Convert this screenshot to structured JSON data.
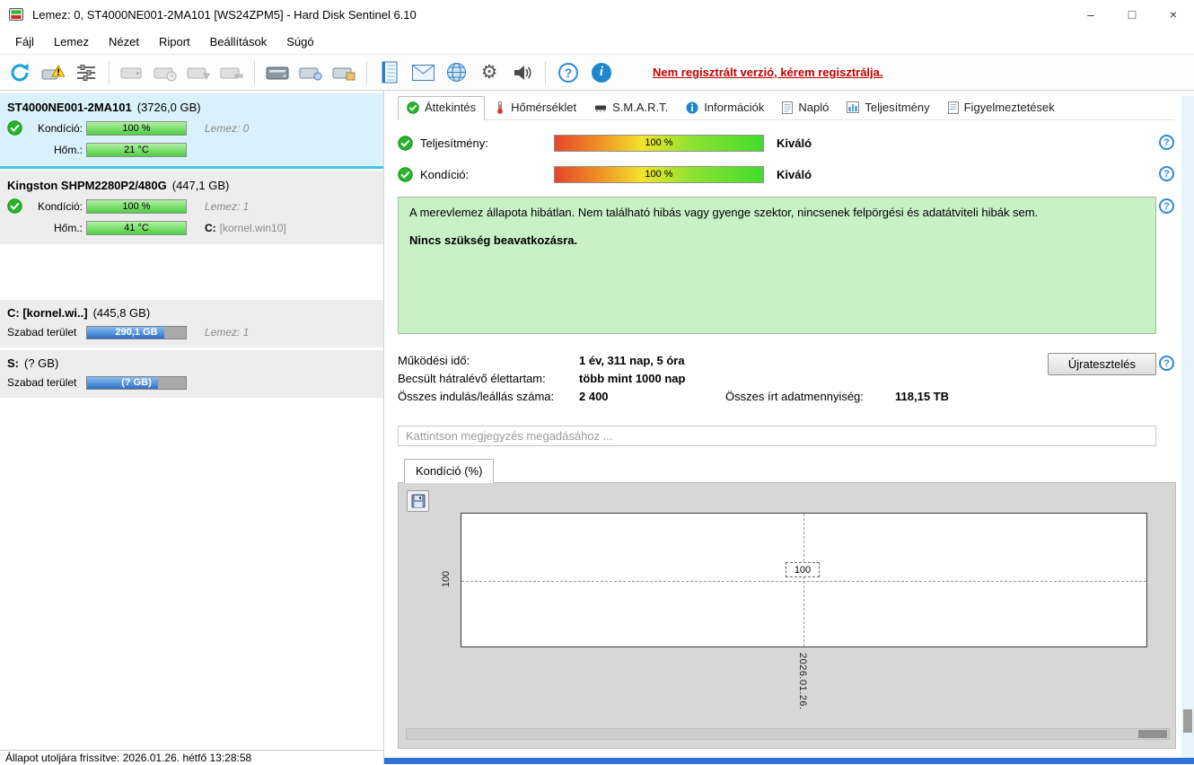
{
  "window": {
    "title": "Lemez: 0, ST4000NE001-2MA101 [WS24ZPM5]  -  Hard Disk Sentinel 6.10",
    "minimize": "–",
    "maximize": "□",
    "close": "×"
  },
  "menu": {
    "items": [
      {
        "label": "Fájl"
      },
      {
        "label": "Lemez"
      },
      {
        "label": "Nézet"
      },
      {
        "label": "Riport"
      },
      {
        "label": "Beállítások"
      },
      {
        "label": "Súgó"
      }
    ]
  },
  "toolbar": {
    "register_text": "Nem regisztrált verzió, kérem regisztrálja.",
    "help_glyph": "?",
    "info_glyph": "i",
    "gear_glyph": "⚙"
  },
  "sidebar": {
    "disks": [
      {
        "name": "ST4000NE001-2MA101",
        "size": "(3726,0 GB)",
        "condition_label": "Kondíció:",
        "condition_value": "100 %",
        "disk_label": "Lemez: 0",
        "temp_label": "Hőm.:",
        "temp_value": "21 °C"
      },
      {
        "name": "Kingston SHPM2280P2/480G",
        "size": "(447,1 GB)",
        "condition_label": "Kondíció:",
        "condition_value": "100 %",
        "disk_label": "Lemez: 1",
        "temp_label": "Hőm.:",
        "temp_value": "41 °C",
        "partition_drive": "C:",
        "partition_name": "[kornel.win10]"
      }
    ],
    "partitions": [
      {
        "name": "C: [kornel.wi..]",
        "size": "(445,8 GB)",
        "free_label": "Szabad terület",
        "free_value": "290,1 GB",
        "disk_label": "Lemez: 1"
      },
      {
        "name": "S:",
        "size": "(? GB)",
        "free_label": "Szabad terület",
        "free_value": "(? GB)",
        "disk_label": ""
      }
    ]
  },
  "main": {
    "tabs": [
      {
        "label": "Áttekintés"
      },
      {
        "label": "Hőmérséklet"
      },
      {
        "label": "S.M.A.R.T."
      },
      {
        "label": "Információk"
      },
      {
        "label": "Napló"
      },
      {
        "label": "Teljesítmény"
      },
      {
        "label": "Figyelmeztetések"
      }
    ],
    "overview": {
      "performance_label": "Teljesítmény:",
      "performance_value": "100 %",
      "performance_rating": "Kiváló",
      "condition_label": "Kondíció:",
      "condition_value": "100 %",
      "condition_rating": "Kiváló",
      "status_text": "A merevlemez állapota hibátlan. Nem található hibás vagy gyenge szektor, nincsenek felpörgési és adatátviteli hibák sem.",
      "status_action": "Nincs szükség beavatkozásra.",
      "stats": [
        {
          "label": "Működési idő:",
          "value": "1 év, 311 nap, 5 óra"
        },
        {
          "label": "Becsült hátralévő élettartam:",
          "value": "több mint 1000 nap"
        },
        {
          "label": "Összes indulás/leállás száma:",
          "value": "2 400"
        }
      ],
      "written_label": "Összes írt adatmennyiség:",
      "written_value": "118,15 TB",
      "retest_button": "Újratesztelés",
      "comment_placeholder": "Kattintson megjegyzés megadásához ..."
    },
    "graph": {
      "tab_label": "Kondíció  (%)",
      "y_tick": "100",
      "point_label": "100",
      "x_label": "2026.01.26."
    }
  },
  "statusbar": {
    "text": "Állapot utoljára frissítve: 2026.01.26. hétfő 13:28:58"
  },
  "chart_data": {
    "type": "line",
    "title": "Kondíció (%)",
    "x": [
      "2026.01.26."
    ],
    "series": [
      {
        "name": "Kondíció",
        "values": [
          100
        ]
      }
    ],
    "y_ticks": [
      100
    ],
    "grid": "dashed",
    "legend": "none"
  }
}
